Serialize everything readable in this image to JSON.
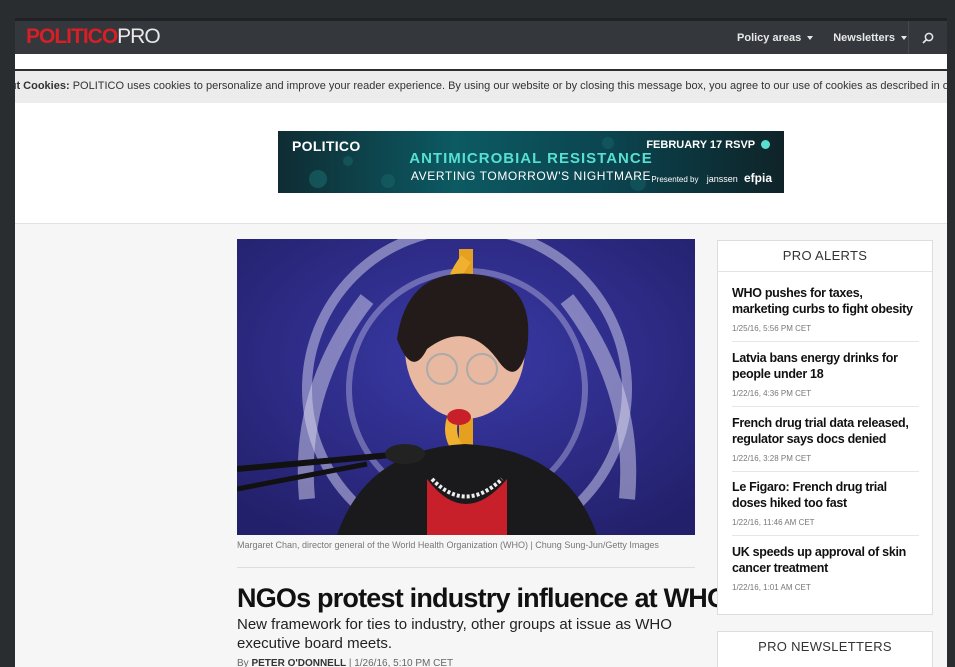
{
  "header": {
    "logo_politico": "POLITICO",
    "logo_pro": "PRO",
    "nav": [
      {
        "label": "Policy areas"
      },
      {
        "label": "Newsletters"
      }
    ],
    "search_icon": "search-icon"
  },
  "cookie_bar": {
    "label": "out Cookies:",
    "text": "POLITICO uses cookies to personalize and improve your reader experience. By using our website or by closing this message box, you agree to our use of cookies as described in ou"
  },
  "ad": {
    "logo": "POLITICO",
    "title": "ANTIMICROBIAL RESISTANCE",
    "subtitle": "AVERTING TOMORROW'S NIGHTMARE",
    "date": "FEBRUARY 17 RSVP",
    "presented": "Presented by",
    "sponsor1": "janssen",
    "sponsor2": "efpia"
  },
  "article": {
    "caption": "Margaret Chan, director general of the World Health Organization (WHO) | Chung Sung-Jun/Getty Images",
    "headline": "NGOs protest industry influence at WHO",
    "deck": "New framework for ties to industry, other groups at issue as WHO executive board meets.",
    "by": "By",
    "author": "PETER O'DONNELL",
    "date": "| 1/26/16, 5:10 PM CET"
  },
  "sidebar": {
    "alerts_title": "PRO ALERTS",
    "alerts": [
      {
        "title": "WHO pushes for taxes, marketing curbs to fight obesity",
        "date": "1/25/16, 5:56 PM CET"
      },
      {
        "title": "Latvia bans energy drinks for people under 18",
        "date": "1/22/16, 4:36 PM CET"
      },
      {
        "title": "French drug trial data released, regulator says docs denied",
        "date": "1/22/16, 3:28 PM CET"
      },
      {
        "title": "Le Figaro: French drug trial doses hiked too fast",
        "date": "1/22/16, 11:46 AM CET"
      },
      {
        "title": "UK speeds up approval of skin cancer treatment",
        "date": "1/22/16, 1:01 AM CET"
      }
    ],
    "newsletters_title": "PRO NEWSLETTERS"
  }
}
